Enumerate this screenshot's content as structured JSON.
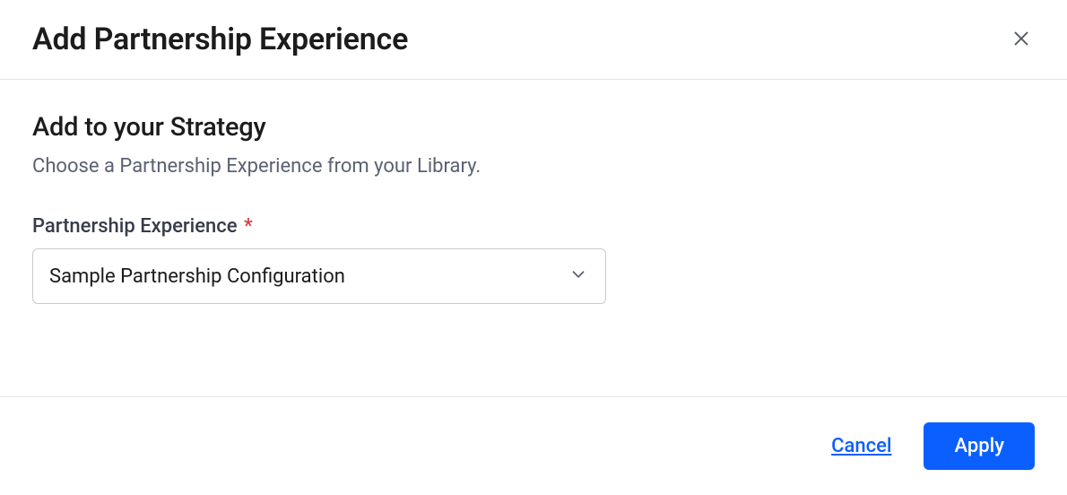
{
  "dialog": {
    "title": "Add Partnership Experience",
    "section_title": "Add to your Strategy",
    "section_subtitle": "Choose a Partnership Experience from your Library.",
    "field_label": "Partnership Experience",
    "required_mark": "*",
    "select_value": "Sample Partnership Configuration",
    "cancel_label": "Cancel",
    "apply_label": "Apply"
  }
}
